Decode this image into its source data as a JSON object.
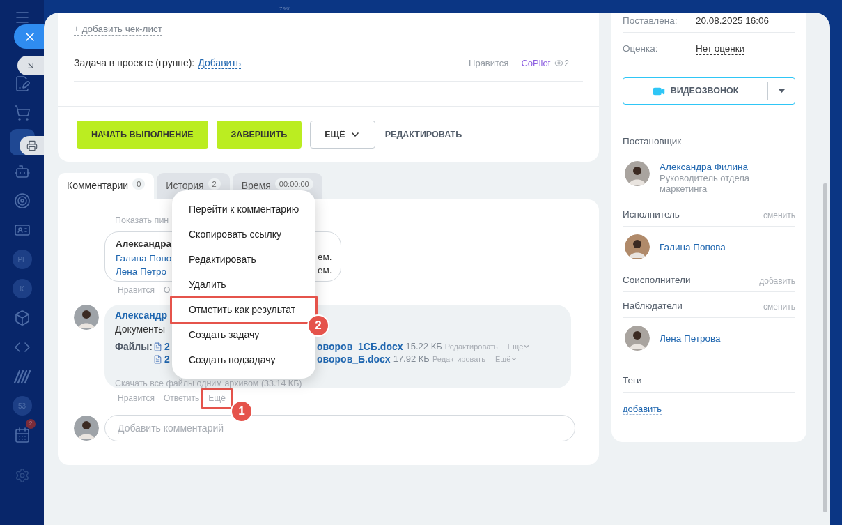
{
  "top_bar": {
    "zoom_label": "79%"
  },
  "sidebar": {
    "items": [
      {
        "kind": "icon",
        "selected": false
      },
      {
        "kind": "icon",
        "selected": false
      },
      {
        "kind": "icon",
        "selected": true
      },
      {
        "kind": "icon",
        "selected": false
      },
      {
        "kind": "icon",
        "selected": false
      },
      {
        "kind": "icon",
        "selected": false
      },
      {
        "kind": "initials",
        "text": "РГ",
        "selected": false
      },
      {
        "kind": "initials",
        "text": "К",
        "selected": false
      },
      {
        "kind": "icon",
        "selected": false
      },
      {
        "kind": "icon",
        "selected": false
      },
      {
        "kind": "icon",
        "selected": false
      },
      {
        "kind": "initials",
        "text": "53",
        "selected": false
      },
      {
        "kind": "icon",
        "selected": false,
        "badge": "2"
      }
    ]
  },
  "task": {
    "checklist_link": "+ добавить чек-лист",
    "project_label": "Задача в проекте (группе):",
    "project_link": "Добавить",
    "like": "Нравится",
    "copilot": "CoPilot",
    "views": "2",
    "buttons": [
      {
        "kind": "primary",
        "label": "НАЧАТЬ ВЫПОЛНЕНИЕ"
      },
      {
        "kind": "primary",
        "label": "ЗАВЕРШИТЬ"
      },
      {
        "kind": "dropdown",
        "label": "ЕЩЁ"
      },
      {
        "kind": "text",
        "label": "РЕДАКТИРОВАТЬ"
      }
    ]
  },
  "tabs": [
    {
      "label": "Комментарии",
      "count": "0",
      "selected": true
    },
    {
      "label": "История",
      "count": "2",
      "selected": false
    },
    {
      "label": "Время",
      "count": "00:00:00",
      "selected": false
    }
  ],
  "comments": {
    "show_pinned": "Показать пин",
    "first": {
      "author": "Александра",
      "lines": [
        "Галина Попо",
        "Лена Петро"
      ],
      "right_fragments": [
        "ем.",
        "ем."
      ],
      "actions": [
        "Нравится",
        "О"
      ]
    },
    "second": {
      "author": "Александр",
      "text": "Документы",
      "files_label": "Файлы:",
      "files": [
        {
          "name_start": "2",
          "name_end": "оворов_1СБ.docx",
          "size": "15.22 КБ",
          "edit": "Редактировать",
          "more": "Ещё"
        },
        {
          "name_start": "2",
          "name_end": "оворов_Б.docx",
          "size": "17.92 КБ",
          "edit": "Редактировать",
          "more": "Ещё"
        }
      ],
      "download": "Скачать все файлы одним архивом (33.14 КБ)",
      "actions": [
        {
          "label": "Нравится",
          "highlighted": false
        },
        {
          "label": "Ответить",
          "highlighted": false
        },
        {
          "label": "Ещё",
          "highlighted": true
        }
      ]
    },
    "input": {
      "placeholder": "Добавить комментарий"
    }
  },
  "context_menu": {
    "items": [
      {
        "label": "Перейти к комментарию",
        "highlighted": false
      },
      {
        "label": "Скопировать ссылку",
        "highlighted": false
      },
      {
        "label": "Редактировать",
        "highlighted": false
      },
      {
        "label": "Удалить",
        "highlighted": false
      },
      {
        "label": "Отметить как результат",
        "highlighted": true
      },
      {
        "label": "Создать задачу",
        "highlighted": false
      },
      {
        "label": "Создать подзадачу",
        "highlighted": false
      }
    ]
  },
  "annotations": [
    {
      "label": "1"
    },
    {
      "label": "2"
    }
  ],
  "details": [
    {
      "label": "Поставлена:",
      "value": "20.08.2025 16:06",
      "kind": "text"
    },
    {
      "label": "Оценка:",
      "value": "Нет оценки",
      "kind": "link"
    }
  ],
  "video_call": {
    "label": "ВИДЕОЗВОНОК"
  },
  "roles": [
    {
      "title": "Постановщик",
      "people": [
        {
          "name": "Александра Филина",
          "position": "Руководитель отдела маркетинга"
        }
      ]
    },
    {
      "title": "Исполнитель",
      "action": "сменить",
      "people": [
        {
          "name": "Галина Попова"
        }
      ]
    },
    {
      "title": "Соисполнители",
      "action": "добавить"
    },
    {
      "title": "Наблюдатели",
      "action": "сменить",
      "people": [
        {
          "name": "Лена Петрова"
        }
      ]
    }
  ],
  "tags": {
    "title": "Теги",
    "add_link": "добавить"
  }
}
